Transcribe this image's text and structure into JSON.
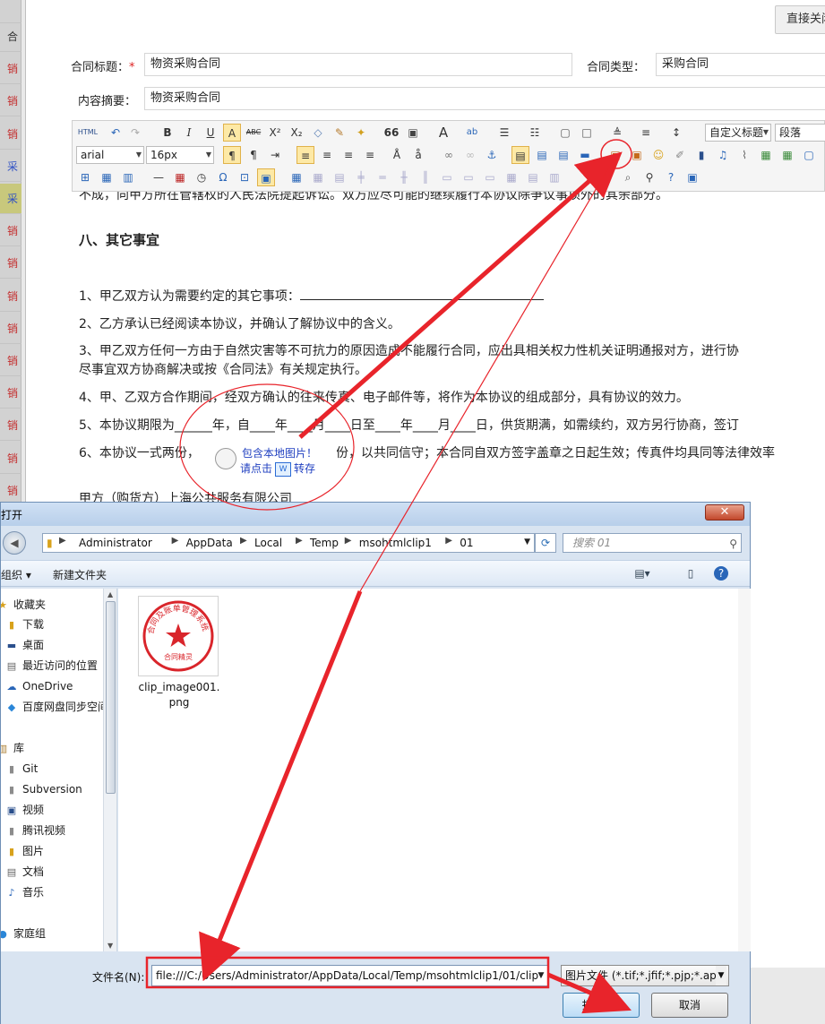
{
  "background_list": {
    "items": [
      {
        "label": "",
        "color": "dark"
      },
      {
        "label": "合",
        "color": "dark"
      },
      {
        "label": "销",
        "color": "red"
      },
      {
        "label": "销",
        "color": "red"
      },
      {
        "label": "销",
        "color": "red"
      },
      {
        "label": "采",
        "color": "blue"
      },
      {
        "label": "采",
        "color": "blue"
      },
      {
        "label": "销",
        "color": "red"
      },
      {
        "label": "销",
        "color": "red"
      },
      {
        "label": "销",
        "color": "red"
      },
      {
        "label": "销",
        "color": "red"
      },
      {
        "label": "销",
        "color": "red"
      },
      {
        "label": "销",
        "color": "red"
      },
      {
        "label": "销",
        "color": "red"
      },
      {
        "label": "销",
        "color": "red"
      },
      {
        "label": "销",
        "color": "red"
      }
    ]
  },
  "editor": {
    "close_button": "直接关闭",
    "title_label": "合同标题：",
    "required_mark": "*",
    "title_value": "物资采购合同",
    "type_label": "合同类型：",
    "type_value": "采购合同",
    "summary_label": "内容摘要：",
    "summary_value": "物资采购合同"
  },
  "toolbar": {
    "row1": {
      "html": "HTML",
      "bold": "B",
      "italic": "I",
      "underline": "U",
      "border": "A",
      "strike": "ABC",
      "sup": "X²",
      "sub": "X₂",
      "quote": "66",
      "fontcolor": "A",
      "custom_title": "自定义标题",
      "paragraph": "段落"
    },
    "row2": {
      "font_family": "arial",
      "font_size": "16px"
    }
  },
  "document": {
    "line_top": "不成，向甲方所在管辖权的人民法院提起诉讼。双方应尽可能的继续履行本协议除争议事项外的其余部分。",
    "heading": "八、其它事宜",
    "p1": "1、甲乙双方认为需要约定的其它事项：",
    "p2": "2、乙方承认已经阅读本协议，并确认了解协议中的含义。",
    "p3a": "3、甲乙双方任何一方由于自然灾害等不可抗力的原因造成不能履行合同，应出具相关权力性机关证明通报对方，进行协",
    "p3b": "尽事宜双方协商解决或按《合同法》有关规定执行。",
    "p4": "4、甲、乙双方合作期间，经双方确认的往来传真、电子邮件等，将作为本协议的组成部分，具有协议的效力。",
    "p5": "5、本协议期限为______年，自____年____月____日至____年____月____日，供货期满，如需续约，双方另行协商，签订",
    "p6a": "6、本协议一式两份，",
    "p6b": "份，以共同信守；本合同自双方签字盖章之日起生效；传真件均具同等法律效率",
    "party_a": "甲方（购货方）上海公共服务有限公司",
    "img_text1": "包含本地图片！",
    "img_text2a": "请点击",
    "img_text2b": "转存"
  },
  "dialog": {
    "title": "打开",
    "breadcrumbs": [
      "Administrator",
      "AppData",
      "Local",
      "Temp",
      "msohtmlclip1",
      "01"
    ],
    "search_placeholder": "搜索 01",
    "organize": "组织 ▾",
    "new_folder": "新建文件夹",
    "nav": [
      {
        "label": "收藏夹",
        "icon": "star-icon",
        "indent": 0
      },
      {
        "label": "下载",
        "icon": "download-icon",
        "indent": 1
      },
      {
        "label": "桌面",
        "icon": "desktop-icon",
        "indent": 1
      },
      {
        "label": "最近访问的位置",
        "icon": "recent-icon",
        "indent": 1
      },
      {
        "label": "OneDrive",
        "icon": "cloud-icon",
        "indent": 1
      },
      {
        "label": "百度网盘同步空间",
        "icon": "baidu-icon",
        "indent": 1
      },
      {
        "label": "",
        "icon": "",
        "indent": 0
      },
      {
        "label": "库",
        "icon": "library-icon",
        "indent": 0
      },
      {
        "label": "Git",
        "icon": "folder-icon",
        "indent": 1
      },
      {
        "label": "Subversion",
        "icon": "folder-icon",
        "indent": 1
      },
      {
        "label": "视频",
        "icon": "video-icon",
        "indent": 1
      },
      {
        "label": "腾讯视频",
        "icon": "folder-icon",
        "indent": 1
      },
      {
        "label": "图片",
        "icon": "picture-icon",
        "indent": 1
      },
      {
        "label": "文档",
        "icon": "document-icon",
        "indent": 1
      },
      {
        "label": "音乐",
        "icon": "music-icon",
        "indent": 1
      },
      {
        "label": "",
        "icon": "",
        "indent": 0
      },
      {
        "label": "家庭组",
        "icon": "homegroup-icon",
        "indent": 0
      }
    ],
    "file": {
      "name": "clip_image001.png",
      "seal_text": "合同及账单管理系统",
      "seal_bottom": "合同精灵"
    },
    "filename_label": "文件名(N):",
    "filename_value": "file:///C:/Users/Administrator/AppData/Local/Temp/msohtmlclip1/01/clip",
    "filetype_value": "图片文件 (*.tif;*.jfif;*.pjp;*.apn",
    "open_button": "打开(O)",
    "cancel_button": "取消"
  },
  "colors": {
    "annotation_red": "#e8242b",
    "seal_red": "#d9252b",
    "link_blue": "#2040c0"
  }
}
